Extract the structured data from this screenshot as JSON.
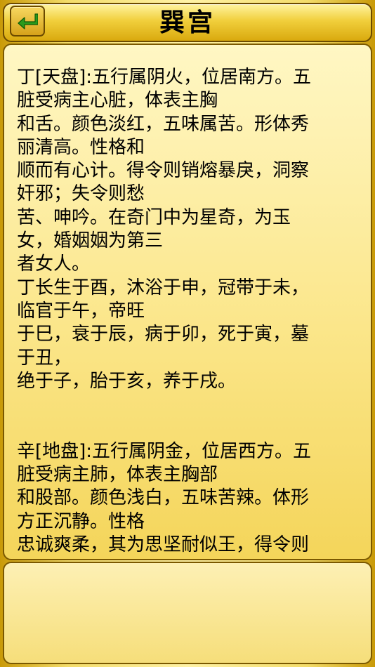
{
  "header": {
    "title": "巽宫",
    "back_icon": "return-arrow-icon"
  },
  "content": {
    "text": "丁[天盘]:五行属阴火，位居南方。五\n脏受病主心脏，体表主胸\n和舌。颜色淡红，五味属苦。形体秀\n丽清高。性格和\n顺而有心计。得令则销熔暴戾，洞察\n奸邪；失令则愁\n苦、呻吟。在奇门中为星奇，为玉\n女，婚姻姻为第三\n者女人。\n丁长生于酉，沐浴于申，冠带于未，\n临官于午，帝旺\n于巳，衰于辰，病于卯，死于寅，墓\n于丑，\n绝于子，胎于亥，养于戌。\n\n\n辛[地盘]:五行属阴金，位居西方。五\n脏受病主肺，体表主胸部\n和股部。颜色浅白，五味苦辣。体形\n方正沉静。性格\n忠诚爽柔，其为思坚耐似王，得令则"
  },
  "colors": {
    "frame_gold": "#d9a90e",
    "panel_light": "#fff7c4",
    "border_dark": "#6b4a00",
    "icon_green": "#2a9a1c"
  }
}
